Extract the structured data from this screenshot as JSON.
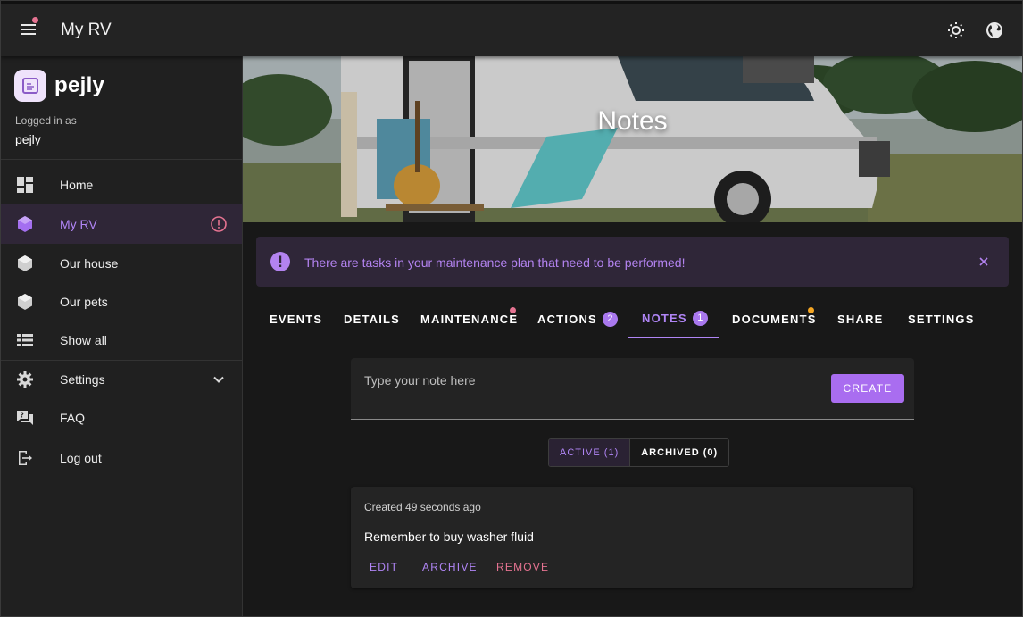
{
  "app_title": "My RV",
  "brand": {
    "name": "pejly"
  },
  "session": {
    "logged_in_label": "Logged in as",
    "username": "pejly"
  },
  "sidebar": {
    "items": [
      {
        "label": "Home",
        "icon": "dashboard-icon"
      },
      {
        "label": "My RV",
        "icon": "cube-icon",
        "active": true,
        "status_icon": "alert-circle-icon"
      },
      {
        "label": "Our house",
        "icon": "cube-icon"
      },
      {
        "label": "Our pets",
        "icon": "cube-icon"
      },
      {
        "label": "Show all",
        "icon": "list-icon"
      },
      {
        "label": "Settings",
        "icon": "gear-icon",
        "expand_icon": "chevron-down-icon"
      },
      {
        "label": "FAQ",
        "icon": "faq-icon"
      },
      {
        "label": "Log out",
        "icon": "logout-icon"
      }
    ]
  },
  "hero": {
    "title": "Notes"
  },
  "alert": {
    "text": "There are tasks in your maintenance plan that need to be performed!"
  },
  "tabs": [
    {
      "label": "EVENTS"
    },
    {
      "label": "DETAILS"
    },
    {
      "label": "MAINTENANCE",
      "dot_color": "#e57391"
    },
    {
      "label": "ACTIONS",
      "badge": "2"
    },
    {
      "label": "NOTES",
      "badge": "1",
      "active": true
    },
    {
      "label": "DOCUMENTS",
      "dot_color": "#f5a623"
    },
    {
      "label": "SHARE"
    },
    {
      "label": "SETTINGS"
    }
  ],
  "note_form": {
    "placeholder": "Type your note here",
    "create_label": "CREATE"
  },
  "filter": {
    "active_label": "ACTIVE (1)",
    "archived_label": "ARCHIVED (0)"
  },
  "notes": [
    {
      "meta": "Created 49 seconds ago",
      "text": "Remember to buy washer fluid",
      "edit_label": "EDIT",
      "archive_label": "ARCHIVE",
      "remove_label": "REMOVE"
    }
  ],
  "colors": {
    "accent": "#b085f5",
    "button": "#a96df0",
    "danger": "#e57391",
    "warning_dot": "#f5a623",
    "background": "#181818"
  }
}
